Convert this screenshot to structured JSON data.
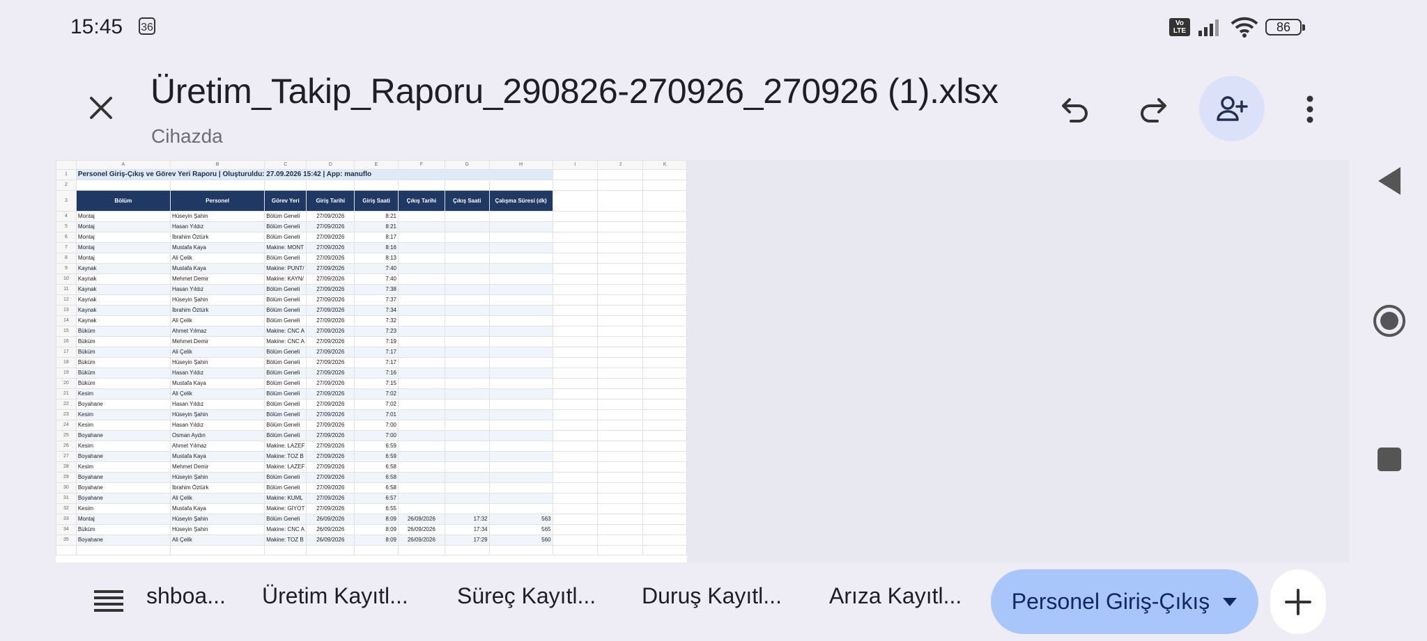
{
  "status_bar": {
    "time": "15:45",
    "notification_count": "36",
    "volte_label": "Vo LTE",
    "battery": "86"
  },
  "header": {
    "title": "Üretim_Takip_Raporu_290826-270926_270926 (1).xlsx",
    "subtitle": "Cihazda",
    "close_icon": "close-icon",
    "undo_icon": "undo-icon",
    "redo_icon": "redo-icon",
    "share_icon": "add-person-icon",
    "more_icon": "more-vert-icon"
  },
  "sheet": {
    "column_letters": [
      "A",
      "B",
      "C",
      "D",
      "E",
      "F",
      "G",
      "H",
      "I",
      "J",
      "K"
    ],
    "title": "Personel Giriş-Çıkış ve Görev Yeri Raporu  |  Oluşturuldu: 27.09.2026 15:42  |  App: manuflo",
    "headers": [
      "Bölüm",
      "Personel",
      "Görev Yeri",
      "Giriş Tarihi",
      "Giriş Saati",
      "Çıkış Tarihi",
      "Çıkış Saati",
      "Çalışma Süresi (dk)"
    ],
    "rows": [
      [
        "Montaj",
        "Hüseyin Şahin",
        "Bölüm Geneli",
        "27/09/2026",
        "8:21",
        "",
        "",
        ""
      ],
      [
        "Montaj",
        "Hasan Yıldız",
        "Bölüm Geneli",
        "27/09/2026",
        "8:21",
        "",
        "",
        ""
      ],
      [
        "Montaj",
        "İbrahim Öztürk",
        "Bölüm Geneli",
        "27/09/2026",
        "8:17",
        "",
        "",
        ""
      ],
      [
        "Montaj",
        "Mustafa Kaya",
        "Makine: MONT",
        "27/09/2026",
        "8:16",
        "",
        "",
        ""
      ],
      [
        "Montaj",
        "Ali Çelik",
        "Bölüm Geneli",
        "27/09/2026",
        "8:13",
        "",
        "",
        ""
      ],
      [
        "Kaynak",
        "Mustafa Kaya",
        "Makine: PUNT/",
        "27/09/2026",
        "7:40",
        "",
        "",
        ""
      ],
      [
        "Kaynak",
        "Mehmet Demir",
        "Makine: KAYN/",
        "27/09/2026",
        "7:40",
        "",
        "",
        ""
      ],
      [
        "Kaynak",
        "Hasan Yıldız",
        "Bölüm Geneli",
        "27/09/2026",
        "7:38",
        "",
        "",
        ""
      ],
      [
        "Kaynak",
        "Hüseyin Şahin",
        "Bölüm Geneli",
        "27/09/2026",
        "7:37",
        "",
        "",
        ""
      ],
      [
        "Kaynak",
        "İbrahim Öztürk",
        "Bölüm Geneli",
        "27/09/2026",
        "7:34",
        "",
        "",
        ""
      ],
      [
        "Kaynak",
        "Ali Çelik",
        "Bölüm Geneli",
        "27/09/2026",
        "7:32",
        "",
        "",
        ""
      ],
      [
        "Büküm",
        "Ahmet Yılmaz",
        "Makine: CNC A",
        "27/09/2026",
        "7:23",
        "",
        "",
        ""
      ],
      [
        "Büküm",
        "Mehmet Demir",
        "Makine: CNC A",
        "27/09/2026",
        "7:19",
        "",
        "",
        ""
      ],
      [
        "Büküm",
        "Ali Çelik",
        "Bölüm Geneli",
        "27/09/2026",
        "7:17",
        "",
        "",
        ""
      ],
      [
        "Büküm",
        "Hüseyin Şahin",
        "Bölüm Geneli",
        "27/09/2026",
        "7:17",
        "",
        "",
        ""
      ],
      [
        "Büküm",
        "Hasan Yıldız",
        "Bölüm Geneli",
        "27/09/2026",
        "7:16",
        "",
        "",
        ""
      ],
      [
        "Büküm",
        "Mustafa Kaya",
        "Bölüm Geneli",
        "27/09/2026",
        "7:15",
        "",
        "",
        ""
      ],
      [
        "Kesim",
        "Ali Çelik",
        "Bölüm Geneli",
        "27/09/2026",
        "7:02",
        "",
        "",
        ""
      ],
      [
        "Boyahane",
        "Hasan Yıldız",
        "Bölüm Geneli",
        "27/09/2026",
        "7:02",
        "",
        "",
        ""
      ],
      [
        "Kesim",
        "Hüseyin Şahin",
        "Bölüm Geneli",
        "27/09/2026",
        "7:01",
        "",
        "",
        ""
      ],
      [
        "Kesim",
        "Hasan Yıldız",
        "Bölüm Geneli",
        "27/09/2026",
        "7:00",
        "",
        "",
        ""
      ],
      [
        "Boyahane",
        "Osman Aydın",
        "Bölüm Geneli",
        "27/09/2026",
        "7:00",
        "",
        "",
        ""
      ],
      [
        "Kesim",
        "Ahmet Yılmaz",
        "Makine: LAZEF",
        "27/09/2026",
        "6:59",
        "",
        "",
        ""
      ],
      [
        "Boyahane",
        "Mustafa Kaya",
        "Makine: TOZ B",
        "27/09/2026",
        "6:59",
        "",
        "",
        ""
      ],
      [
        "Kesim",
        "Mehmet Demir",
        "Makine: LAZEF",
        "27/09/2026",
        "6:58",
        "",
        "",
        ""
      ],
      [
        "Boyahane",
        "Hüseyin Şahin",
        "Bölüm Geneli",
        "27/09/2026",
        "6:58",
        "",
        "",
        ""
      ],
      [
        "Boyahane",
        "İbrahim Öztürk",
        "Bölüm Geneli",
        "27/09/2026",
        "6:58",
        "",
        "",
        ""
      ],
      [
        "Boyahane",
        "Ali Çelik",
        "Makine: KUML",
        "27/09/2026",
        "6:57",
        "",
        "",
        ""
      ],
      [
        "Kesim",
        "Mustafa Kaya",
        "Makine: GİYOT",
        "27/09/2026",
        "6:55",
        "",
        "",
        ""
      ],
      [
        "Montaj",
        "Hüseyin Şahin",
        "Bölüm Geneli",
        "26/09/2026",
        "8:09",
        "26/09/2026",
        "17:32",
        "563"
      ],
      [
        "Büküm",
        "Hüseyin Şahin",
        "Makine: CNC A",
        "26/09/2026",
        "8:09",
        "26/09/2026",
        "17:34",
        "565"
      ],
      [
        "Boyahane",
        "Ali Çelik",
        "Makine: TOZ B",
        "26/09/2026",
        "8:09",
        "26/09/2026",
        "17:29",
        "560"
      ]
    ]
  },
  "tabs": {
    "menu_icon": "list-icon",
    "items": [
      "shboa...",
      "Üretim Kayıtl...",
      "Süreç Kayıtl...",
      "Duruş Kayıtl...",
      "Arıza Kayıtl..."
    ],
    "active": "Personel Giriş-Çıkış",
    "add_icon": "plus-icon"
  },
  "nav": {
    "back_icon": "back-triangle-icon",
    "home_icon": "home-circle-icon",
    "recents_icon": "recents-square-icon"
  }
}
